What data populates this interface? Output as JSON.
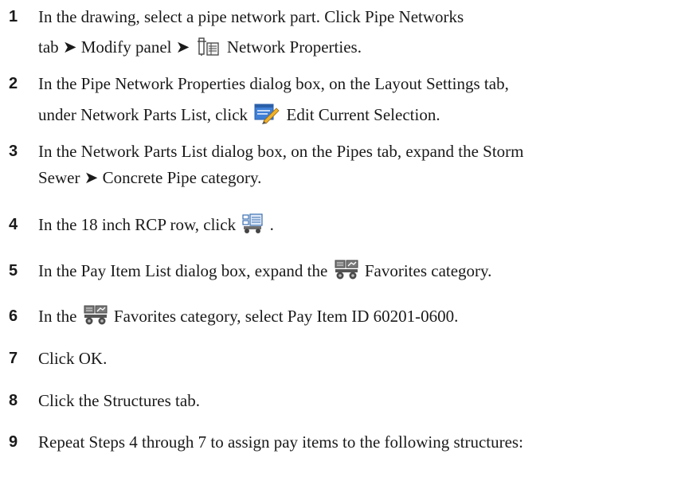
{
  "steps": [
    {
      "number": "1",
      "lines": [
        "In the drawing, select a pipe network part. Click Pipe Networks",
        {
          "before": "tab ➤ Modify panel ➤",
          "icon": "network-properties-icon",
          "after": "Network Properties."
        }
      ]
    },
    {
      "number": "2",
      "lines": [
        "In the Pipe Network Properties dialog box, on the Layout Settings tab,",
        {
          "before": "under Network Parts List, click",
          "icon": "edit-current-selection-icon",
          "after": "Edit Current Selection."
        }
      ]
    },
    {
      "number": "3",
      "lines": [
        "In the Network Parts List dialog box, on the Pipes tab, expand the Storm",
        "Sewer ➤ Concrete Pipe category."
      ]
    },
    {
      "number": "4",
      "lines": [
        {
          "before": "In the 18 inch RCP row, click",
          "icon": "pay-item-list-icon",
          "after": "."
        }
      ]
    },
    {
      "number": "5",
      "lines": [
        {
          "before": "In the Pay Item List dialog box, expand the",
          "icon": "favorites-category-icon",
          "after": "Favorites category."
        }
      ]
    },
    {
      "number": "6",
      "lines": [
        {
          "before": "In the",
          "icon": "favorites-category-icon",
          "after": "Favorites category, select Pay Item ID 60201-0600."
        }
      ]
    },
    {
      "number": "7",
      "lines": [
        "Click OK."
      ]
    },
    {
      "number": "8",
      "lines": [
        "Click the Structures tab."
      ]
    },
    {
      "number": "9",
      "lines": [
        "Repeat Steps 4 through 7 to assign pay items to the following structures:"
      ]
    }
  ]
}
